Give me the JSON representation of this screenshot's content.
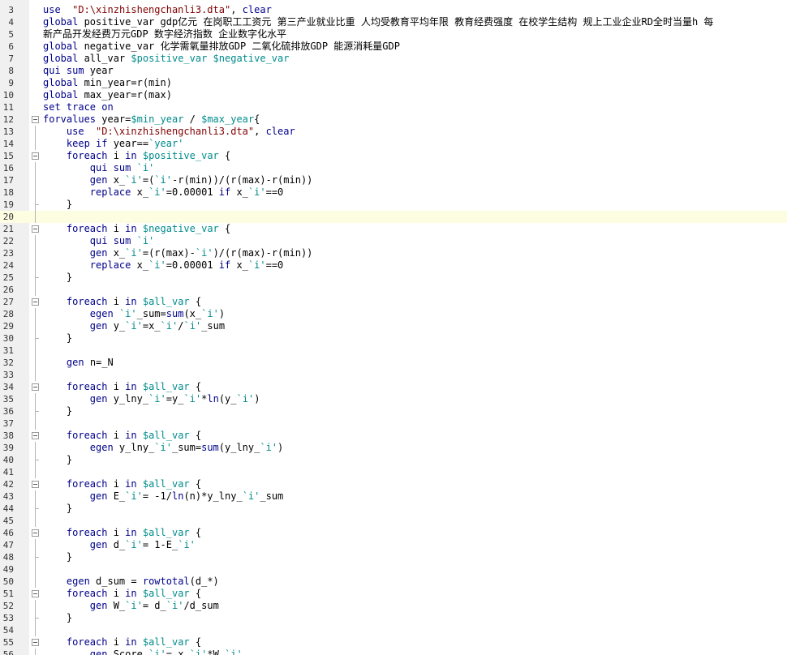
{
  "lines": [
    {
      "num": "3",
      "fold": "",
      "cur": false,
      "tokens": [
        [
          "kw",
          "use"
        ],
        [
          "",
          "  "
        ],
        [
          "str",
          "\"D:\\xinzhishengchanli3.dta\""
        ],
        [
          "",
          ", "
        ],
        [
          "kw",
          "clear"
        ]
      ]
    },
    {
      "num": "4",
      "fold": "",
      "cur": false,
      "tokens": [
        [
          "kw",
          "global"
        ],
        [
          "",
          " positive_var gdp亿元 在岗职工工资元 第三产业就业比重 人均受教育平均年限 教育经费强度 在校学生结构 规上工业企业RD全时当量h 每"
        ]
      ]
    },
    {
      "num": "5",
      "fold": "",
      "cur": false,
      "tokens": [
        [
          "",
          "新产品开发经费万元GDP 数字经济指数 企业数字化水平"
        ]
      ]
    },
    {
      "num": "6",
      "fold": "",
      "cur": false,
      "tokens": [
        [
          "kw",
          "global"
        ],
        [
          "",
          "",
          " negative_var 化学需氧量排放GDP 二氧化硫排放GDP 能源消耗量GDP"
        ]
      ]
    },
    {
      "num": "7",
      "fold": "",
      "cur": false,
      "tokens": [
        [
          "kw",
          "global"
        ],
        [
          "",
          "",
          " all_var "
        ],
        [
          "mac",
          "$positive_var"
        ],
        [
          "",
          " "
        ],
        [
          "mac",
          "$negative_var"
        ]
      ]
    },
    {
      "num": "8",
      "fold": "",
      "cur": false,
      "tokens": [
        [
          "kw",
          "qui sum"
        ],
        [
          "",
          " year"
        ]
      ]
    },
    {
      "num": "9",
      "fold": "",
      "cur": false,
      "tokens": [
        [
          "kw",
          "global"
        ],
        [
          "",
          " min_year=r(min)"
        ]
      ]
    },
    {
      "num": "10",
      "fold": "",
      "cur": false,
      "tokens": [
        [
          "kw",
          "global"
        ],
        [
          "",
          " max_year=r(max)"
        ]
      ]
    },
    {
      "num": "11",
      "fold": "",
      "cur": false,
      "tokens": [
        [
          "kw",
          "set trace on"
        ]
      ]
    },
    {
      "num": "12",
      "fold": "open",
      "cur": false,
      "tokens": [
        [
          "kw",
          "forvalues"
        ],
        [
          "",
          " year="
        ],
        [
          "mac",
          "$min_year"
        ],
        [
          "",
          " / "
        ],
        [
          "mac",
          "$max_year"
        ],
        [
          "",
          "{"
        ]
      ]
    },
    {
      "num": "13",
      "fold": "line",
      "cur": false,
      "tokens": [
        [
          "",
          "    "
        ],
        [
          "kw",
          "use"
        ],
        [
          "",
          "  "
        ],
        [
          "str",
          "\"D:\\xinzhishengchanli3.dta\""
        ],
        [
          "",
          ", "
        ],
        [
          "kw",
          "clear"
        ]
      ]
    },
    {
      "num": "14",
      "fold": "line",
      "cur": false,
      "tokens": [
        [
          "",
          "    "
        ],
        [
          "kw",
          "keep if"
        ],
        [
          "",
          " year=="
        ],
        [
          "mac",
          "`year'"
        ]
      ]
    },
    {
      "num": "15",
      "fold": "open",
      "cur": false,
      "tokens": [
        [
          "",
          "    "
        ],
        [
          "kw",
          "foreach"
        ],
        [
          "",
          " i "
        ],
        [
          "kw",
          "in"
        ],
        [
          "",
          " "
        ],
        [
          "mac",
          "$positive_var"
        ],
        [
          "",
          " {"
        ]
      ]
    },
    {
      "num": "16",
      "fold": "line",
      "cur": false,
      "tokens": [
        [
          "",
          "        "
        ],
        [
          "kw",
          "qui sum"
        ],
        [
          "",
          " "
        ],
        [
          "mac",
          "`i'"
        ]
      ]
    },
    {
      "num": "17",
      "fold": "line",
      "cur": false,
      "tokens": [
        [
          "",
          "        "
        ],
        [
          "kw",
          "gen"
        ],
        [
          "",
          " x_"
        ],
        [
          "mac",
          "`i'"
        ],
        [
          "",
          "=("
        ],
        [
          "mac",
          "`i'"
        ],
        [
          "",
          "-r(min))/(r(max)-r(min))"
        ]
      ]
    },
    {
      "num": "18",
      "fold": "line",
      "cur": false,
      "tokens": [
        [
          "",
          "        "
        ],
        [
          "kw",
          "replace"
        ],
        [
          "",
          " x_"
        ],
        [
          "mac",
          "`i'"
        ],
        [
          "",
          "=0.00001 "
        ],
        [
          "kw",
          "if"
        ],
        [
          "",
          " x_"
        ],
        [
          "mac",
          "`i'"
        ],
        [
          "",
          "==0"
        ]
      ]
    },
    {
      "num": "19",
      "fold": "end",
      "cur": false,
      "tokens": [
        [
          "",
          "    }"
        ]
      ]
    },
    {
      "num": "20",
      "fold": "line",
      "cur": true,
      "tokens": [
        [
          "",
          ""
        ]
      ]
    },
    {
      "num": "21",
      "fold": "open",
      "cur": false,
      "tokens": [
        [
          "",
          "    "
        ],
        [
          "kw",
          "foreach"
        ],
        [
          "",
          " i "
        ],
        [
          "kw",
          "in"
        ],
        [
          "",
          " "
        ],
        [
          "mac",
          "$negative_var"
        ],
        [
          "",
          " {"
        ]
      ]
    },
    {
      "num": "22",
      "fold": "line",
      "cur": false,
      "tokens": [
        [
          "",
          "        "
        ],
        [
          "kw",
          "qui sum"
        ],
        [
          "",
          " "
        ],
        [
          "mac",
          "`i'"
        ]
      ]
    },
    {
      "num": "23",
      "fold": "line",
      "cur": false,
      "tokens": [
        [
          "",
          "        "
        ],
        [
          "kw",
          "gen"
        ],
        [
          "",
          " x_"
        ],
        [
          "mac",
          "`i'"
        ],
        [
          "",
          "=(r(max)-"
        ],
        [
          "mac",
          "`i'"
        ],
        [
          "",
          ")/(r(max)-r(min))"
        ]
      ]
    },
    {
      "num": "24",
      "fold": "line",
      "cur": false,
      "tokens": [
        [
          "",
          "        "
        ],
        [
          "kw",
          "replace"
        ],
        [
          "",
          " x_"
        ],
        [
          "mac",
          "`i'"
        ],
        [
          "",
          "=0.00001 "
        ],
        [
          "kw",
          "if"
        ],
        [
          "",
          " x_"
        ],
        [
          "mac",
          "`i'"
        ],
        [
          "",
          "==0"
        ]
      ]
    },
    {
      "num": "25",
      "fold": "end",
      "cur": false,
      "tokens": [
        [
          "",
          "    }"
        ]
      ]
    },
    {
      "num": "26",
      "fold": "line",
      "cur": false,
      "tokens": [
        [
          "",
          ""
        ]
      ]
    },
    {
      "num": "27",
      "fold": "open",
      "cur": false,
      "tokens": [
        [
          "",
          "    "
        ],
        [
          "kw",
          "foreach"
        ],
        [
          "",
          " i "
        ],
        [
          "kw",
          "in"
        ],
        [
          "",
          " "
        ],
        [
          "mac",
          "$all_var"
        ],
        [
          "",
          " {"
        ]
      ]
    },
    {
      "num": "28",
      "fold": "line",
      "cur": false,
      "tokens": [
        [
          "",
          "        "
        ],
        [
          "kw",
          "egen"
        ],
        [
          "",
          " "
        ],
        [
          "mac",
          "`i'"
        ],
        [
          "",
          "_sum="
        ],
        [
          "fn",
          "sum"
        ],
        [
          "",
          "(x_"
        ],
        [
          "mac",
          "`i'"
        ],
        [
          "",
          ")"
        ]
      ]
    },
    {
      "num": "29",
      "fold": "line",
      "cur": false,
      "tokens": [
        [
          "",
          "        "
        ],
        [
          "kw",
          "gen"
        ],
        [
          "",
          " y_"
        ],
        [
          "mac",
          "`i'"
        ],
        [
          "",
          "=x_"
        ],
        [
          "mac",
          "`i'"
        ],
        [
          "",
          "/"
        ],
        [
          "mac",
          "`i'"
        ],
        [
          "",
          "_sum"
        ]
      ]
    },
    {
      "num": "30",
      "fold": "end",
      "cur": false,
      "tokens": [
        [
          "",
          "    }"
        ]
      ]
    },
    {
      "num": "31",
      "fold": "line",
      "cur": false,
      "tokens": [
        [
          "",
          ""
        ]
      ]
    },
    {
      "num": "32",
      "fold": "line",
      "cur": false,
      "tokens": [
        [
          "",
          "    "
        ],
        [
          "kw",
          "gen"
        ],
        [
          "",
          " n=_N"
        ]
      ]
    },
    {
      "num": "33",
      "fold": "line",
      "cur": false,
      "tokens": [
        [
          "",
          ""
        ]
      ]
    },
    {
      "num": "34",
      "fold": "open",
      "cur": false,
      "tokens": [
        [
          "",
          "    "
        ],
        [
          "kw",
          "foreach"
        ],
        [
          "",
          " i "
        ],
        [
          "kw",
          "in"
        ],
        [
          "",
          " "
        ],
        [
          "mac",
          "$all_var"
        ],
        [
          "",
          " {"
        ]
      ]
    },
    {
      "num": "35",
      "fold": "line",
      "cur": false,
      "tokens": [
        [
          "",
          "        "
        ],
        [
          "kw",
          "gen"
        ],
        [
          "",
          " y_lny_"
        ],
        [
          "mac",
          "`i'"
        ],
        [
          "",
          "=y_"
        ],
        [
          "mac",
          "`i'"
        ],
        [
          "",
          "*"
        ],
        [
          "fn",
          "ln"
        ],
        [
          "",
          "(y_"
        ],
        [
          "mac",
          "`i'"
        ],
        [
          "",
          ")"
        ]
      ]
    },
    {
      "num": "36",
      "fold": "end",
      "cur": false,
      "tokens": [
        [
          "",
          "    }"
        ]
      ]
    },
    {
      "num": "37",
      "fold": "line",
      "cur": false,
      "tokens": [
        [
          "",
          ""
        ]
      ]
    },
    {
      "num": "38",
      "fold": "open",
      "cur": false,
      "tokens": [
        [
          "",
          "    "
        ],
        [
          "kw",
          "foreach"
        ],
        [
          "",
          " i "
        ],
        [
          "kw",
          "in"
        ],
        [
          "",
          " "
        ],
        [
          "mac",
          "$all_var"
        ],
        [
          "",
          " {"
        ]
      ]
    },
    {
      "num": "39",
      "fold": "line",
      "cur": false,
      "tokens": [
        [
          "",
          "        "
        ],
        [
          "kw",
          "egen"
        ],
        [
          "",
          " y_lny_"
        ],
        [
          "mac",
          "`i'"
        ],
        [
          "",
          "_sum="
        ],
        [
          "fn",
          "sum"
        ],
        [
          "",
          "(y_lny_"
        ],
        [
          "mac",
          "`i'"
        ],
        [
          "",
          ")"
        ]
      ]
    },
    {
      "num": "40",
      "fold": "end",
      "cur": false,
      "tokens": [
        [
          "",
          "    }"
        ]
      ]
    },
    {
      "num": "41",
      "fold": "line",
      "cur": false,
      "tokens": [
        [
          "",
          ""
        ]
      ]
    },
    {
      "num": "42",
      "fold": "open",
      "cur": false,
      "tokens": [
        [
          "",
          "    "
        ],
        [
          "kw",
          "foreach"
        ],
        [
          "",
          " i "
        ],
        [
          "kw",
          "in"
        ],
        [
          "",
          " "
        ],
        [
          "mac",
          "$all_var"
        ],
        [
          "",
          " {"
        ]
      ]
    },
    {
      "num": "43",
      "fold": "line",
      "cur": false,
      "tokens": [
        [
          "",
          "        "
        ],
        [
          "kw",
          "gen"
        ],
        [
          "",
          " E_"
        ],
        [
          "mac",
          "`i'"
        ],
        [
          "",
          "= -1/"
        ],
        [
          "fn",
          "ln"
        ],
        [
          "",
          "(n)*y_lny_"
        ],
        [
          "mac",
          "`i'"
        ],
        [
          "",
          "_sum"
        ]
      ]
    },
    {
      "num": "44",
      "fold": "end",
      "cur": false,
      "tokens": [
        [
          "",
          "    }"
        ]
      ]
    },
    {
      "num": "45",
      "fold": "line",
      "cur": false,
      "tokens": [
        [
          "",
          ""
        ]
      ]
    },
    {
      "num": "46",
      "fold": "open",
      "cur": false,
      "tokens": [
        [
          "",
          "    "
        ],
        [
          "kw",
          "foreach"
        ],
        [
          "",
          " i "
        ],
        [
          "kw",
          "in"
        ],
        [
          "",
          " "
        ],
        [
          "mac",
          "$all_var"
        ],
        [
          "",
          " {"
        ]
      ]
    },
    {
      "num": "47",
      "fold": "line",
      "cur": false,
      "tokens": [
        [
          "",
          "        "
        ],
        [
          "kw",
          "gen"
        ],
        [
          "",
          " d_"
        ],
        [
          "mac",
          "`i'"
        ],
        [
          "",
          "= 1-E_"
        ],
        [
          "mac",
          "`i'"
        ]
      ]
    },
    {
      "num": "48",
      "fold": "end",
      "cur": false,
      "tokens": [
        [
          "",
          "    }"
        ]
      ]
    },
    {
      "num": "49",
      "fold": "line",
      "cur": false,
      "tokens": [
        [
          "",
          ""
        ]
      ]
    },
    {
      "num": "50",
      "fold": "line",
      "cur": false,
      "tokens": [
        [
          "",
          "    "
        ],
        [
          "kw",
          "egen"
        ],
        [
          "",
          " d_sum = "
        ],
        [
          "fn",
          "rowtotal"
        ],
        [
          "",
          "(d_*)"
        ]
      ]
    },
    {
      "num": "51",
      "fold": "open",
      "cur": false,
      "tokens": [
        [
          "",
          "    "
        ],
        [
          "kw",
          "foreach"
        ],
        [
          "",
          " i "
        ],
        [
          "kw",
          "in"
        ],
        [
          "",
          " "
        ],
        [
          "mac",
          "$all_var"
        ],
        [
          "",
          " {"
        ]
      ]
    },
    {
      "num": "52",
      "fold": "line",
      "cur": false,
      "tokens": [
        [
          "",
          "        "
        ],
        [
          "kw",
          "gen"
        ],
        [
          "",
          " W_"
        ],
        [
          "mac",
          "`i'"
        ],
        [
          "",
          "= d_"
        ],
        [
          "mac",
          "`i'"
        ],
        [
          "",
          "/d_sum"
        ]
      ]
    },
    {
      "num": "53",
      "fold": "end",
      "cur": false,
      "tokens": [
        [
          "",
          "    }"
        ]
      ]
    },
    {
      "num": "54",
      "fold": "line",
      "cur": false,
      "tokens": [
        [
          "",
          ""
        ]
      ]
    },
    {
      "num": "55",
      "fold": "open",
      "cur": false,
      "tokens": [
        [
          "",
          "    "
        ],
        [
          "kw",
          "foreach"
        ],
        [
          "",
          " i "
        ],
        [
          "kw",
          "in"
        ],
        [
          "",
          " "
        ],
        [
          "mac",
          "$all_var"
        ],
        [
          "",
          " {"
        ]
      ]
    },
    {
      "num": "56",
      "fold": "line",
      "cur": false,
      "tokens": [
        [
          "",
          "        "
        ],
        [
          "kw",
          "gen"
        ],
        [
          "",
          " Score_"
        ],
        [
          "mac",
          "`i'"
        ],
        [
          "",
          "= x_"
        ],
        [
          "mac",
          "`i'"
        ],
        [
          "",
          "*W_"
        ],
        [
          "mac",
          "`i'"
        ]
      ]
    }
  ]
}
